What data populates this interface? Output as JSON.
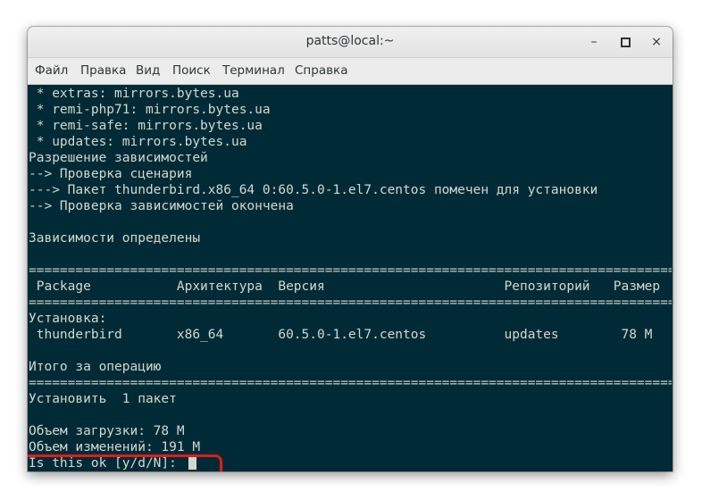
{
  "window": {
    "title": "patts@local:~",
    "buttons": {
      "minimize": "–",
      "close": "×"
    }
  },
  "menu": [
    "Файл",
    "Правка",
    "Вид",
    "Поиск",
    "Терминал",
    "Справка"
  ],
  "terminal": {
    "lines": [
      " * extras: mirrors.bytes.ua",
      " * remi-php71: mirrors.bytes.ua",
      " * remi-safe: mirrors.bytes.ua",
      " * updates: mirrors.bytes.ua",
      "Разрешение зависимостей",
      "--> Проверка сценария",
      "---> Пакет thunderbird.x86_64 0:60.5.0-1.el7.centos помечен для установки",
      "--> Проверка зависимостей окончена",
      "",
      "Зависимости определены",
      "",
      "==========================================================================================",
      " Package           Архитектура  Версия                       Репозиторий   Размер",
      "==========================================================================================",
      "Установка:",
      " thunderbird       x86_64       60.5.0-1.el7.centos          updates        78 M",
      "",
      "Итого за операцию",
      "==========================================================================================",
      "Установить  1 пакет",
      "",
      "Объем загрузки: 78 M",
      "Объем изменений: 191 M",
      "Is this ok [y/d/N]: "
    ]
  },
  "colors": {
    "terminal_bg": "#002b36",
    "terminal_fg": "#d3d7cf",
    "highlight": "#e31b1b"
  }
}
